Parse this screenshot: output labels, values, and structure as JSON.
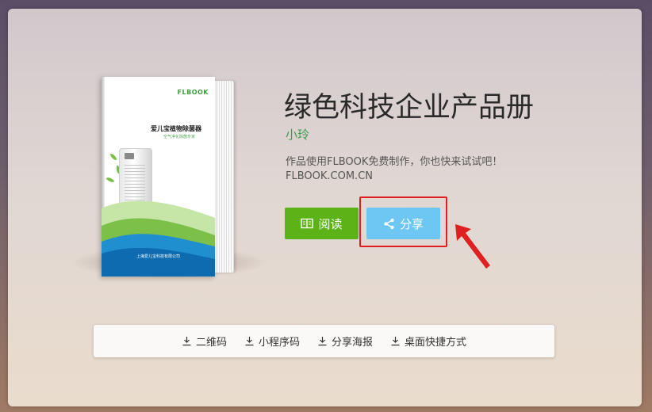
{
  "book": {
    "title": "绿色科技企业产品册",
    "author": "小玲",
    "desc_line1": "作品使用FLBOOK免费制作，你也快来试试吧！",
    "desc_line2": "FLBOOK.COM.CN"
  },
  "cover": {
    "logo": "FLBOOK",
    "title": "爱儿宝植物除菌器",
    "subtitle": "空气净化除菌专家",
    "footer": "上海爱儿宝科技有限公司"
  },
  "buttons": {
    "read_label": "阅读",
    "share_label": "分享"
  },
  "download": {
    "items": [
      "二维码",
      "小程序码",
      "分享海报",
      "桌面快捷方式"
    ]
  },
  "colors": {
    "read": "#5cb217",
    "share": "#6ec6f2",
    "highlight": "#e02020",
    "author": "#3d9b4e"
  }
}
